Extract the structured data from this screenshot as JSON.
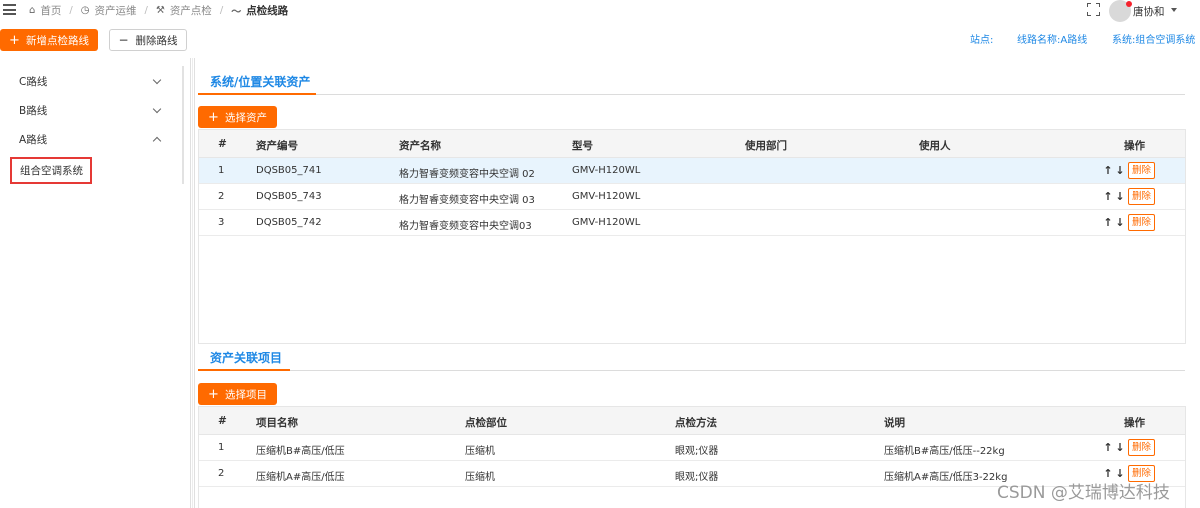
{
  "breadcrumb": {
    "items": [
      {
        "icon": "home-icon",
        "glyph": "⌂",
        "label": "首页"
      },
      {
        "icon": "clock-icon",
        "glyph": "◷",
        "label": "资产运维"
      },
      {
        "icon": "tools-icon",
        "glyph": "⚒",
        "label": "资产点检"
      },
      {
        "icon": "route-icon",
        "glyph": "〜",
        "label": "点检线路"
      }
    ],
    "separator": "/"
  },
  "header": {
    "user_name": "唐协和",
    "notification_color": "#f5222d"
  },
  "toolbar": {
    "add_route_label": "新增点检路线",
    "delete_route_label": "删除路线",
    "site_label": "站点:",
    "route_name_label": "线路名称:A路线",
    "system_label": "系统:组合空调系统"
  },
  "sidebar": {
    "items": [
      {
        "label": "C路线",
        "expanded": false
      },
      {
        "label": "B路线",
        "expanded": false
      },
      {
        "label": "A路线",
        "expanded": true
      }
    ],
    "selected_child": "组合空调系统"
  },
  "asset_panel": {
    "tab_title": "系统/位置关联资产",
    "select_button": "选择资产",
    "columns": [
      "#",
      "资产编号",
      "资产名称",
      "型号",
      "使用部门",
      "使用人",
      "操作"
    ],
    "rows": [
      {
        "idx": "1",
        "code": "DQSB05_741",
        "name": "格力智睿变频变容中央空调 02",
        "model": "GMV-H120WL",
        "dept": "",
        "user": ""
      },
      {
        "idx": "2",
        "code": "DQSB05_743",
        "name": "格力智睿变频变容中央空调 03",
        "model": "GMV-H120WL",
        "dept": "",
        "user": ""
      },
      {
        "idx": "3",
        "code": "DQSB05_742",
        "name": "格力智睿变频变容中央空调03",
        "model": "GMV-H120WL",
        "dept": "",
        "user": ""
      }
    ],
    "up_glyph": "↑",
    "down_glyph": "↓",
    "delete_label": "删除"
  },
  "item_panel": {
    "tab_title": "资产关联项目",
    "select_button": "选择项目",
    "columns": [
      "#",
      "项目名称",
      "点检部位",
      "点检方法",
      "说明",
      "操作"
    ],
    "rows": [
      {
        "idx": "1",
        "name": "压缩机B#高压/低压",
        "part": "压缩机",
        "method": "眼观;仪器",
        "desc": "压缩机B#高压/低压--22kg"
      },
      {
        "idx": "2",
        "name": "压缩机A#高压/低压",
        "part": "压缩机",
        "method": "眼观;仪器",
        "desc": "压缩机A#高压/低压3-22kg"
      }
    ],
    "up_glyph": "↑",
    "down_glyph": "↓",
    "delete_label": "删除"
  },
  "watermark": "CSDN @艾瑞博达科技",
  "colors": {
    "accent": "#ff6a00",
    "link": "#1e88e5",
    "highlight_row": "#e8f4fd",
    "selection_border": "#e53935"
  }
}
